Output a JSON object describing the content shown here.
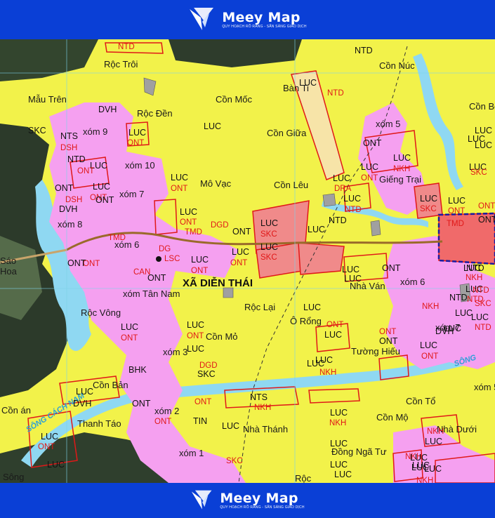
{
  "brand": {
    "name": "Meey Map",
    "tagline": "QUY HOẠCH RÕ RÀNG - SẴN SÀNG GIAO DỊCH",
    "icon": "meey-logo-icon",
    "color": "#0a3fd6"
  },
  "map": {
    "commune": "XÃ DIỄN THÁI",
    "rivers": [
      "SÔNG CÁCH NAM",
      "SÔNG"
    ],
    "colors": {
      "agri_land": "#f2f24a",
      "residential": "#f5a0f0",
      "industrial": "#f08080",
      "forest": "#2e3b2e",
      "water": "#8fd8f2",
      "boundary": "#e01818",
      "admin_boundary": "#1a1aa0"
    },
    "places": [
      "Rộc Trôi",
      "Mẫu Trên",
      "Rộc Đền",
      "Cồn Mốc",
      "Cồn Giữa",
      "Mô Vạc",
      "Cồn Lêu",
      "Bàn Ti",
      "Cồn Núc",
      "Cồn Bê",
      "xóm 9",
      "xóm 10",
      "xóm 7",
      "xóm 8",
      "xóm 6",
      "xóm Tân Nam",
      "xóm 5",
      "Giếng Trại",
      "Rộc Vông",
      "Cồn Mỏ",
      "Rộc Lại",
      "Ô Rổng",
      "Nhà Ván",
      "xóm 6",
      "xóm 7",
      "Tường Hiếu",
      "xóm 3",
      "Cồn Bản",
      "Cồn án",
      "Thanh Táo",
      "xóm 2",
      "Nhà Thánh",
      "xóm 1",
      "Cồn Mộ",
      "Cồn Tổ",
      "xóm 5",
      "Nhà Dưới",
      "Đồng Ngã Tư",
      "Rộc",
      "Sáo",
      "Hoa",
      "Sông"
    ],
    "codes": [
      "LUC",
      "ONT",
      "SKC",
      "DVH",
      "NTS",
      "NTD",
      "TMD",
      "DGD",
      "CAN",
      "TIN",
      "BHK",
      "NKH",
      "DRA",
      "DSH"
    ],
    "labels": [
      {
        "t": "NTD",
        "k": "sub"
      },
      {
        "t": "NTD",
        "k": "code"
      },
      {
        "t": "LUC",
        "k": "code"
      },
      {
        "t": "NTD",
        "k": "sub"
      },
      {
        "t": "DVH",
        "k": "code"
      },
      {
        "t": "SKC",
        "k": "code"
      },
      {
        "t": "NTS",
        "k": "code"
      },
      {
        "t": "DSH",
        "k": "sub"
      },
      {
        "t": "LUC",
        "k": "code"
      },
      {
        "t": "ONT",
        "k": "sub"
      },
      {
        "t": "NTD",
        "k": "code"
      },
      {
        "t": "LUC",
        "k": "code"
      },
      {
        "t": "ONT",
        "k": "sub"
      },
      {
        "t": "ONT",
        "k": "code"
      },
      {
        "t": "LUC",
        "k": "code"
      },
      {
        "t": "ONT",
        "k": "sub"
      },
      {
        "t": "ONT",
        "k": "code"
      },
      {
        "t": "DSH",
        "k": "sub"
      },
      {
        "t": "DVH",
        "k": "code"
      },
      {
        "t": "LUC",
        "k": "code"
      },
      {
        "t": "LUC",
        "k": "code"
      },
      {
        "t": "ONT",
        "k": "sub"
      },
      {
        "t": "LUC",
        "k": "code"
      },
      {
        "t": "ONT",
        "k": "sub"
      },
      {
        "t": "TMD",
        "k": "sub"
      },
      {
        "t": "DGD",
        "k": "sub"
      },
      {
        "t": "ONT",
        "k": "code"
      },
      {
        "t": "LUC",
        "k": "code"
      },
      {
        "t": "SKC",
        "k": "sub"
      },
      {
        "t": "LUC",
        "k": "code"
      },
      {
        "t": "SKC",
        "k": "sub"
      },
      {
        "t": "LUC",
        "k": "code"
      },
      {
        "t": "LUC",
        "k": "code"
      },
      {
        "t": "ONT",
        "k": "sub"
      },
      {
        "t": "LUC",
        "k": "code"
      },
      {
        "t": "ONT",
        "k": "sub"
      },
      {
        "t": "TMD",
        "k": "sub"
      },
      {
        "t": "DG",
        "k": "sub"
      },
      {
        "t": "LSC",
        "k": "sub"
      },
      {
        "t": "ONT",
        "k": "code"
      },
      {
        "t": "ONT",
        "k": "sub"
      },
      {
        "t": "ONT",
        "k": "code"
      },
      {
        "t": "CAN",
        "k": "sub"
      },
      {
        "t": "LUC",
        "k": "code"
      },
      {
        "t": "ONT",
        "k": "sub"
      },
      {
        "t": "LUC",
        "k": "code"
      },
      {
        "t": "ONT",
        "k": "sub"
      },
      {
        "t": "LUC",
        "k": "code"
      },
      {
        "t": "SKC",
        "k": "sub"
      },
      {
        "t": "LUC",
        "k": "code"
      },
      {
        "t": "ONT",
        "k": "sub"
      },
      {
        "t": "LUC",
        "k": "code"
      },
      {
        "t": "DRA",
        "k": "sub"
      },
      {
        "t": "LUC",
        "k": "code"
      },
      {
        "t": "NTD",
        "k": "sub"
      },
      {
        "t": "NTD",
        "k": "code"
      },
      {
        "t": "ONT",
        "k": "code"
      },
      {
        "t": "LUC",
        "k": "code"
      },
      {
        "t": "ONT",
        "k": "sub"
      },
      {
        "t": "LUC",
        "k": "code"
      },
      {
        "t": "NKH",
        "k": "sub"
      },
      {
        "t": "LUC",
        "k": "code"
      },
      {
        "t": "LUC",
        "k": "code"
      },
      {
        "t": "SKC",
        "k": "sub"
      },
      {
        "t": "LUC",
        "k": "code"
      },
      {
        "t": "NKH",
        "k": "sub"
      },
      {
        "t": "LUC",
        "k": "code"
      },
      {
        "t": "NTD",
        "k": "sub"
      },
      {
        "t": "TMD",
        "k": "sub"
      },
      {
        "t": "NTD",
        "k": "code"
      },
      {
        "t": "NTD",
        "k": "sub"
      },
      {
        "t": "NTD",
        "k": "code"
      },
      {
        "t": "SKC",
        "k": "sub"
      },
      {
        "t": "LUC",
        "k": "code"
      },
      {
        "t": "NTD",
        "k": "sub"
      },
      {
        "t": "LUC",
        "k": "code"
      },
      {
        "t": "ONT",
        "k": "code"
      },
      {
        "t": "LUC",
        "k": "code"
      },
      {
        "t": "LUC",
        "k": "code"
      },
      {
        "t": "NKH",
        "k": "sub"
      },
      {
        "t": "LUC",
        "k": "code"
      },
      {
        "t": "ONT",
        "k": "sub"
      },
      {
        "t": "LUC",
        "k": "code"
      },
      {
        "t": "ONT",
        "k": "sub"
      },
      {
        "t": "ONT",
        "k": "code"
      },
      {
        "t": "LUC",
        "k": "code"
      },
      {
        "t": "ONT",
        "k": "sub"
      },
      {
        "t": "DVH",
        "k": "code"
      },
      {
        "t": "LUC",
        "k": "code"
      },
      {
        "t": "LUC",
        "k": "code"
      },
      {
        "t": "DGD",
        "k": "sub"
      },
      {
        "t": "SKC",
        "k": "code"
      },
      {
        "t": "BHK",
        "k": "code"
      },
      {
        "t": "LUC",
        "k": "code"
      },
      {
        "t": "NKH",
        "k": "sub"
      },
      {
        "t": "LUC",
        "k": "code"
      },
      {
        "t": "ONT",
        "k": "sub"
      },
      {
        "t": "ONT",
        "k": "code"
      },
      {
        "t": "ONT",
        "k": "sub"
      },
      {
        "t": "TIN",
        "k": "code"
      },
      {
        "t": "LUC",
        "k": "code"
      },
      {
        "t": "NTS",
        "k": "code"
      },
      {
        "t": "NKH",
        "k": "sub"
      },
      {
        "t": "LUC",
        "k": "code"
      },
      {
        "t": "NKH",
        "k": "sub"
      },
      {
        "t": "LUC",
        "k": "code"
      },
      {
        "t": "NKH",
        "k": "sub"
      },
      {
        "t": "LUC",
        "k": "code"
      },
      {
        "t": "NKH",
        "k": "sub"
      },
      {
        "t": "LUC",
        "k": "code"
      },
      {
        "t": "LUC",
        "k": "code"
      },
      {
        "t": "NKH",
        "k": "sub"
      },
      {
        "t": "LUC",
        "k": "code"
      },
      {
        "t": "DVH",
        "k": "code"
      },
      {
        "t": "LUC",
        "k": "code"
      },
      {
        "t": "ONT",
        "k": "sub"
      },
      {
        "t": "LUC",
        "k": "code"
      },
      {
        "t": "SKC",
        "k": "sub"
      },
      {
        "t": "LUC",
        "k": "code"
      },
      {
        "t": "LUC",
        "k": "code"
      },
      {
        "t": "LUC",
        "k": "code"
      },
      {
        "t": "LUC",
        "k": "code"
      },
      {
        "t": "ONT",
        "k": "sub"
      },
      {
        "t": "ONT",
        "k": "code"
      },
      {
        "t": "LUC",
        "k": "code"
      },
      {
        "t": "LUC",
        "k": "code"
      }
    ]
  }
}
